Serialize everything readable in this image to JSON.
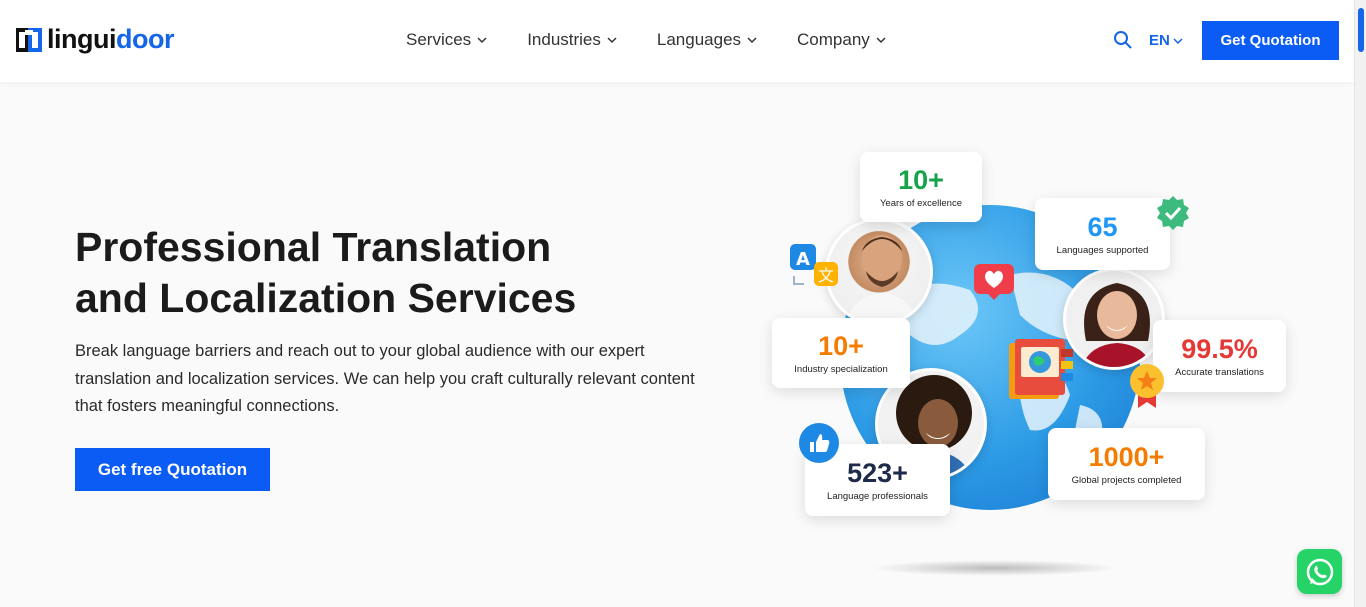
{
  "brand": {
    "name_prefix": "lingui",
    "name_suffix": "door",
    "accent": "#1565e8",
    "primary_button": "#0b5cf5"
  },
  "nav": {
    "items": [
      {
        "label": "Services"
      },
      {
        "label": "Industries"
      },
      {
        "label": "Languages"
      },
      {
        "label": "Company"
      }
    ],
    "language": "EN",
    "quote_button": "Get Quotation"
  },
  "hero": {
    "title_line1": "Professional Translation",
    "title_line2": "and Localization Services",
    "description": "Break language barriers and reach out to your global audience with our expert translation and localization services. We can help you craft culturally relevant content that fosters meaningful connections.",
    "cta": "Get free Quotation"
  },
  "stats": [
    {
      "value": "10+",
      "label": "Years of excellence",
      "color": "#16a34a"
    },
    {
      "value": "65",
      "label": "Languages supported",
      "color": "#2196f3"
    },
    {
      "value": "10+",
      "label": "Industry specialization",
      "color": "#f57c00"
    },
    {
      "value": "99.5%",
      "label": "Accurate translations",
      "color": "#e53935"
    },
    {
      "value": "523+",
      "label": "Language professionals",
      "color": "#1e2a4a"
    },
    {
      "value": "1000+",
      "label": "Global projects completed",
      "color": "#f57c00"
    }
  ],
  "icons": {
    "search": "search-icon",
    "whatsapp": "whatsapp-icon",
    "translate": "translate-icon",
    "heart": "heart-icon",
    "verified": "verified-badge-icon",
    "like": "thumbs-up-icon",
    "medal": "medal-icon",
    "book": "book-icon"
  }
}
